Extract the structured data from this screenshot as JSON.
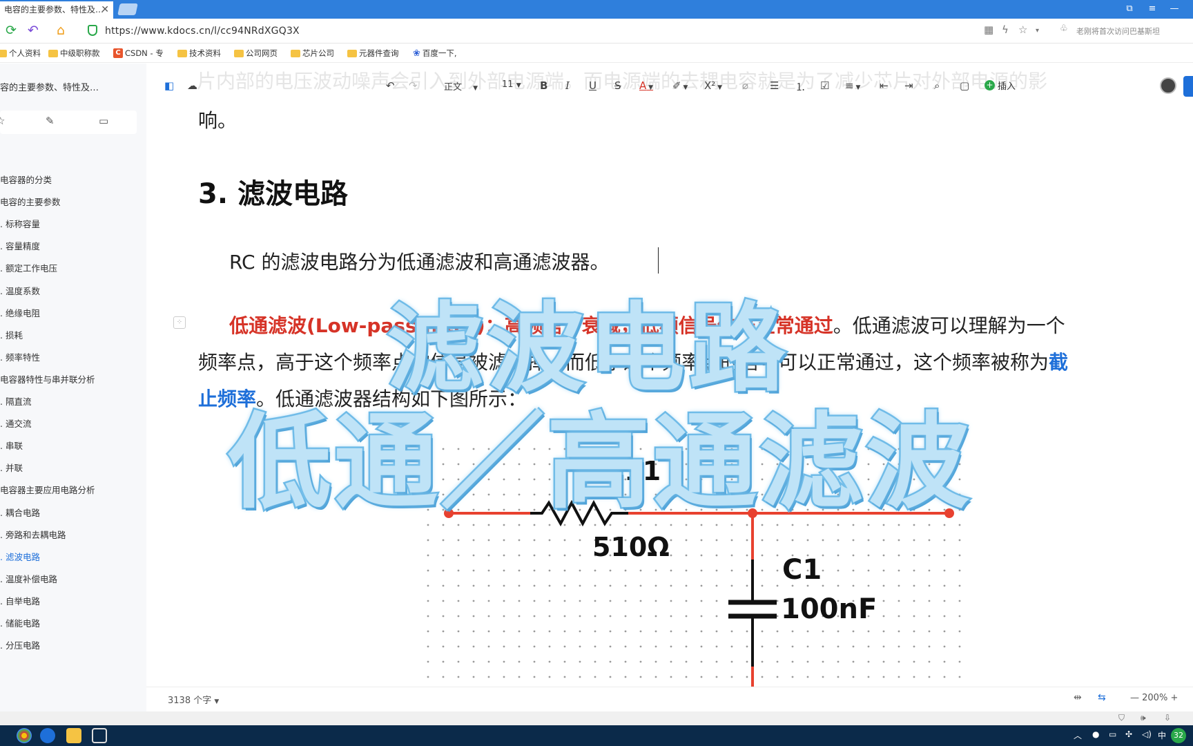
{
  "browser": {
    "tab_title": "电容的主要参数、特性及…",
    "tab_close": "✕",
    "url": "https://www.kdocs.cn/l/cc94NRdXGQ3X",
    "hint_text": "老刚将首次访问巴基斯坦",
    "bookmarks": [
      "个人资料",
      "中级职称款",
      "CSDN - 专",
      "技术资料",
      "公司网页",
      "芯片公司",
      "元器件查询",
      "百度一下,"
    ]
  },
  "sidebar": {
    "doc_title": "容的主要参数、特性及…",
    "toc": [
      {
        "label": "电容器的分类",
        "active": false
      },
      {
        "label": "电容的主要参数",
        "active": false
      },
      {
        "label": ". 标称容量",
        "active": false
      },
      {
        "label": ". 容量精度",
        "active": false
      },
      {
        "label": ". 额定工作电压",
        "active": false
      },
      {
        "label": ". 温度系数",
        "active": false
      },
      {
        "label": ". 绝缘电阻",
        "active": false
      },
      {
        "label": ". 损耗",
        "active": false
      },
      {
        "label": ". 频率特性",
        "active": false
      },
      {
        "label": "电容器特性与串并联分析",
        "active": false
      },
      {
        "label": ". 隔直流",
        "active": false
      },
      {
        "label": ". 通交流",
        "active": false
      },
      {
        "label": ". 串联",
        "active": false
      },
      {
        "label": ". 并联",
        "active": false
      },
      {
        "label": "电容器主要应用电路分析",
        "active": false
      },
      {
        "label": ". 耦合电路",
        "active": false
      },
      {
        "label": ". 旁路和去耦电路",
        "active": false
      },
      {
        "label": ". 滤波电路",
        "active": true
      },
      {
        "label": ". 温度补偿电路",
        "active": false
      },
      {
        "label": ". 自举电路",
        "active": false
      },
      {
        "label": ". 储能电路",
        "active": false
      },
      {
        "label": ". 分压电路",
        "active": false
      }
    ]
  },
  "toolbar": {
    "style": "正文",
    "font_size": "11",
    "insert_label": "插入"
  },
  "document": {
    "ghost_line": "片内部的电压波动噪声会引入到外部电源端。而电源端的去耦电容就是为了减少芯片对外部电源的影",
    "line_end": "响。",
    "heading": "3.  滤波电路",
    "para1": "RC 的滤波电路分为低通滤波和高通滤波器。",
    "para2_red_1": "低通滤波(Low-pass filter)",
    "para2_hidden": "：高频信号衰减，低频信号",
    "para2_red_2": "信号正常通过",
    "para2_rest_1": "。低通滤波可以理解为一个",
    "para2_line2": "频率点，高于这个频率点的信号被滤除掉，而低于这个频率点的信号可以正常通过，这个频率被称为",
    "para2_blue_1": "截",
    "para2_blue_2": "止频率",
    "para2_line3": "。低通滤波器结构如下图所示："
  },
  "circuit": {
    "resistor_label": "R11",
    "resistor_value": "510Ω",
    "capacitor_label": "C1",
    "capacitor_value": "100nF",
    "wire_color": "#e8412f"
  },
  "overlay": {
    "line1": "滤波电路",
    "line2": "低通／高通滤波"
  },
  "status": {
    "word_count": "3138 个字",
    "zoom": "200%"
  },
  "tray": {
    "ime": "中",
    "badge": "32"
  }
}
